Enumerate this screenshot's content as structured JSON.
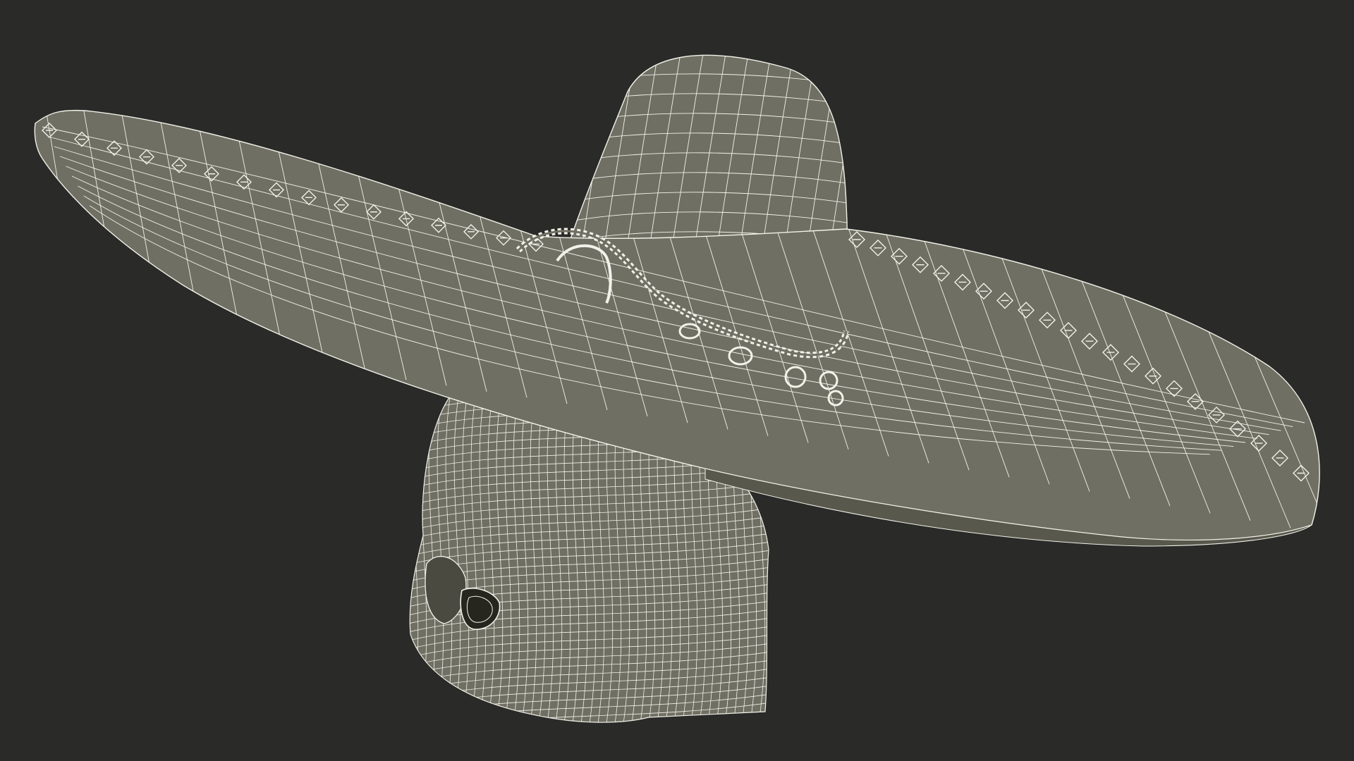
{
  "scene": {
    "subject": "wireframe-render",
    "background_color": "#2a2a28",
    "surface_color": "#6f6f63",
    "surface_shadow_color": "#58584d",
    "wire_color": "#f2f2ea",
    "objects": [
      {
        "id": "sombrero-hat",
        "name": "sombrero"
      },
      {
        "id": "skull-head",
        "name": "skull"
      }
    ]
  }
}
